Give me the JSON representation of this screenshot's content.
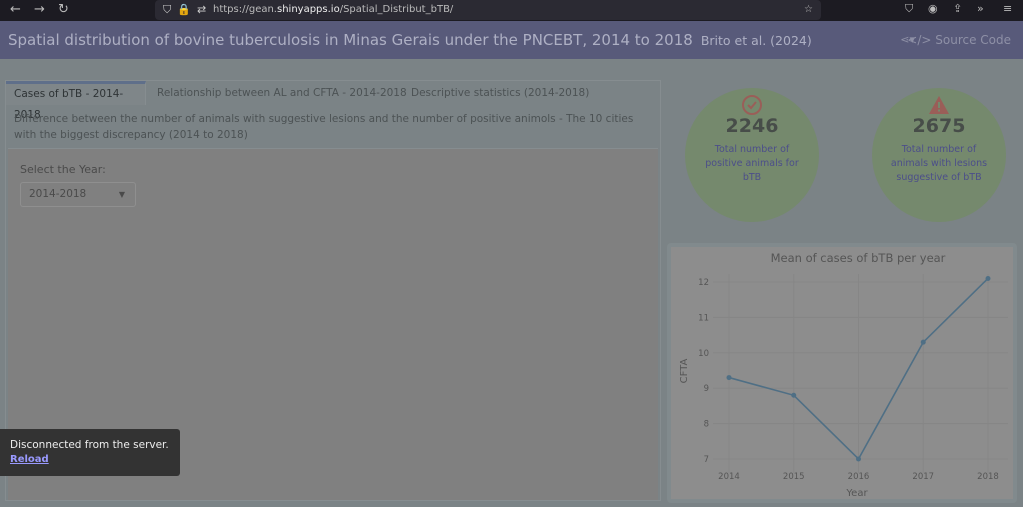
{
  "browser": {
    "url_host": "https://gean.",
    "url_domain": "shinyapps.io",
    "url_path": "/Spatial_Distribut_bTB/"
  },
  "header": {
    "title": "Spatial distribution of bovine tuberculosis in Minas Gerais under the PNCEBT, 2014 to 2018",
    "subtitle": "Brito et al. (2024)",
    "source_code": "Source Code"
  },
  "tabs": [
    {
      "label": "Cases of bTB - 2014-2018",
      "active": true
    },
    {
      "label": "Relationship between AL and CFTA - 2014-2018"
    },
    {
      "label": "Descriptive statistics (2014-2018)"
    }
  ],
  "description": "Difference between the number of animals with suggestive lesions and the number of positive animols - The 10 cities with the biggest discrepancy (2014 to 2018)",
  "year_select": {
    "label": "Select the Year:",
    "value": "2014-2018"
  },
  "stats": [
    {
      "icon": "check-circle-icon",
      "value": "2246",
      "caption": "Total number of positive animals for bTB"
    },
    {
      "icon": "warning-icon",
      "value": "2675",
      "caption": "Total number of animals with lesions suggestive of bTB"
    }
  ],
  "toast": {
    "message": "Disconnected from the server.",
    "link": "Reload"
  },
  "colors": {
    "header": "#585a7a",
    "circle": "#75896d",
    "line": "#4f6f85"
  },
  "chart_data": {
    "type": "line",
    "title": "Mean of cases of bTB per year",
    "xlabel": "Year",
    "ylabel": "CFTA",
    "x": [
      2014,
      2015,
      2016,
      2017,
      2018
    ],
    "values": [
      9.3,
      8.8,
      7.0,
      10.3,
      12.1
    ],
    "yticks": [
      7,
      8,
      9,
      10,
      11,
      12
    ],
    "xticks": [
      "2014",
      "2015",
      "2016",
      "2017",
      "2018"
    ],
    "ylim": [
      6.7,
      12.4
    ],
    "grid": true
  }
}
